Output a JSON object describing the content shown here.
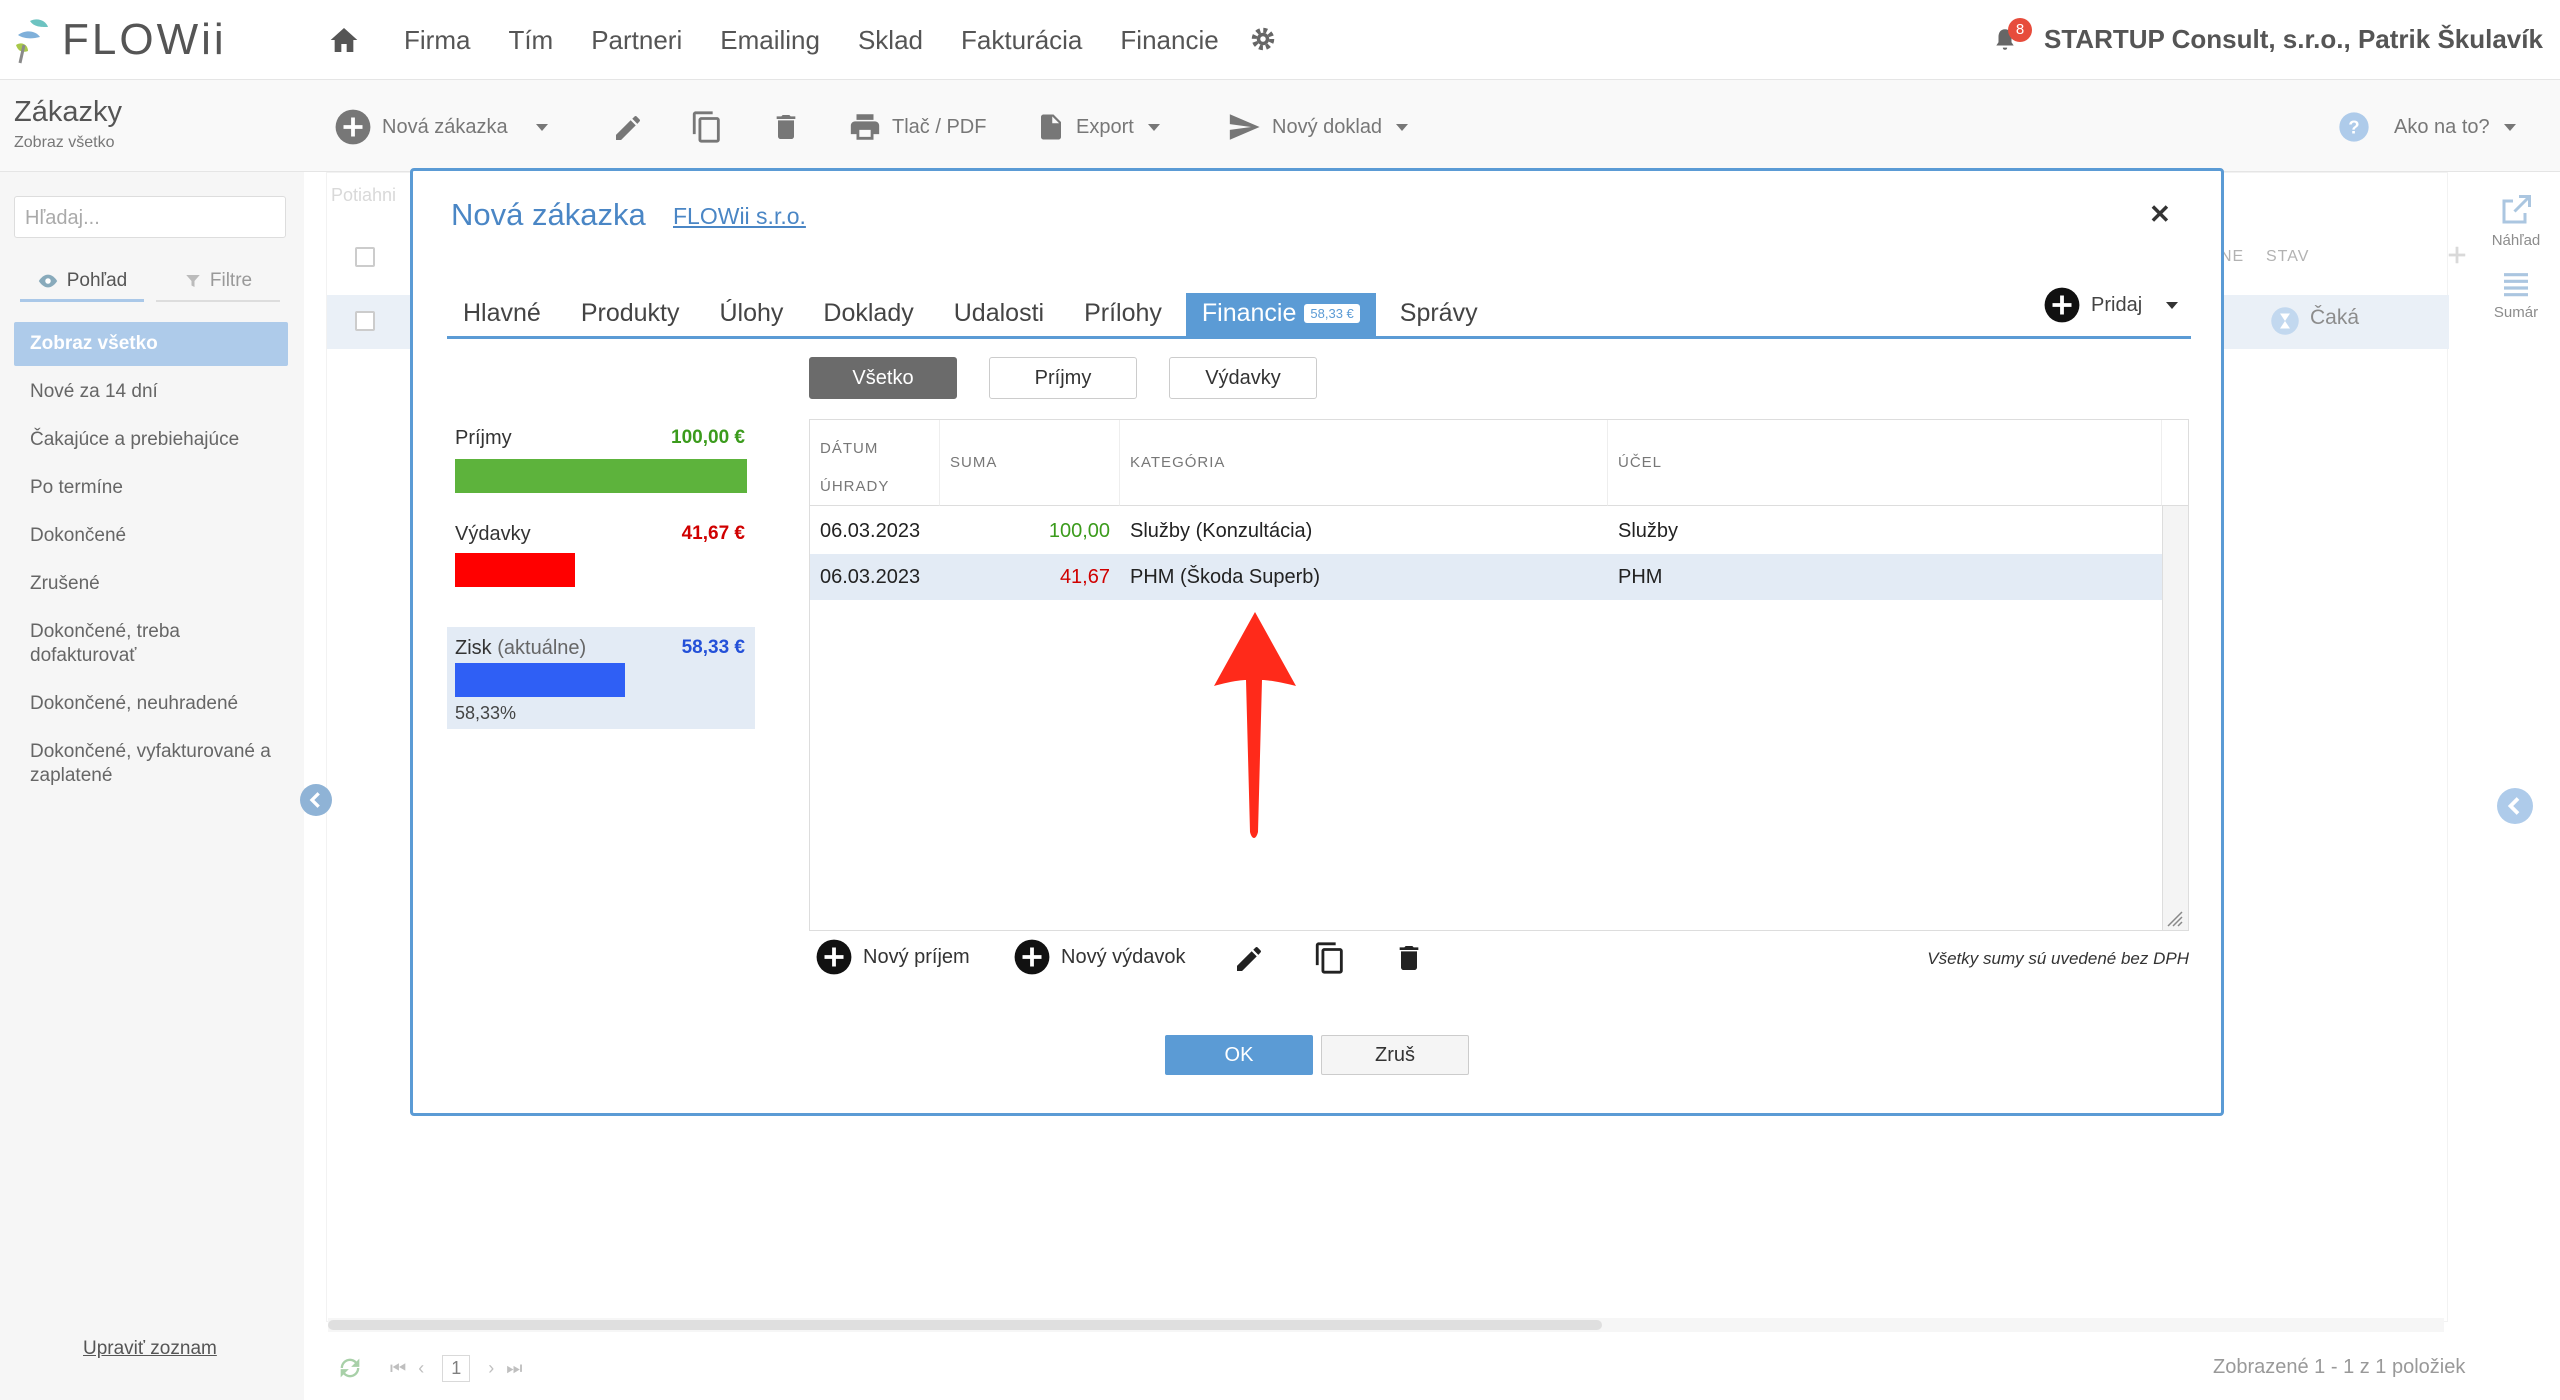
{
  "app": {
    "name": "FLOWii"
  },
  "nav": {
    "items": [
      "Firma",
      "Tím",
      "Partneri",
      "Emailing",
      "Sklad",
      "Fakturácia",
      "Financie"
    ]
  },
  "user": {
    "company": "STARTUP Consult, s.r.o., Patrik Škulavík",
    "notifications": "8"
  },
  "page": {
    "title": "Zákazky",
    "subtitle": "Zobraz všetko"
  },
  "toolbar": {
    "new_order": "Nová zákazka",
    "print": "Tlač / PDF",
    "export": "Export",
    "new_doc": "Nový doklad",
    "help": "Ako na to?"
  },
  "sidebar": {
    "search_placeholder": "Hľadaj...",
    "tab_view": "Pohľad",
    "tab_filter": "Filtre",
    "items": [
      "Zobraz všetko",
      "Nové za 14 dní",
      "Čakajúce a prebiehajúce",
      "Po termíne",
      "Dokončené",
      "Zrušené",
      "Dokončené, treba dofakturovať",
      "Dokončené, neuhradené",
      "Dokončené, vyfakturované a zaplatené"
    ],
    "edit_list": "Upraviť zoznam"
  },
  "list": {
    "col_ne": "NE",
    "col_stav": "STAV",
    "status_value": "Čaká",
    "drag_hint": "Potiahni",
    "footer": "Zobrazené 1 - 1 z 1 položiek",
    "page": "1"
  },
  "rail": {
    "preview": "Náhľad",
    "summary": "Sumár"
  },
  "modal": {
    "title": "Nová zákazka",
    "client_link": "FLOWii s.r.o.",
    "tabs": [
      "Hlavné",
      "Produkty",
      "Úlohy",
      "Doklady",
      "Udalosti",
      "Prílohy",
      "Financie",
      "Správy"
    ],
    "active_tab": "Financie",
    "active_badge": "58,33 €",
    "add_label": "Pridaj",
    "filters": [
      "Všetko",
      "Príjmy",
      "Výdavky"
    ],
    "income_label": "Príjmy",
    "income_value": "100,00 €",
    "expense_label": "Výdavky",
    "expense_value": "41,67 €",
    "profit_label": "Zisk",
    "profit_note": "(aktuálne)",
    "profit_value": "58,33 €",
    "profit_pct": "58,33%",
    "income_color": "#5db33c",
    "expense_color": "#ff0000",
    "profit_color": "#2f5ff5",
    "grid": {
      "headers": [
        "DÁTUM ÚHRADY",
        "SUMA",
        "KATEGÓRIA",
        "ÚČEL"
      ],
      "rows": [
        {
          "date": "06.03.2023",
          "amount": "100,00",
          "category": "Služby (Konzultácia)",
          "purpose": "Služby"
        },
        {
          "date": "06.03.2023",
          "amount": "41,67",
          "category": "PHM (Škoda Superb)",
          "purpose": "PHM"
        }
      ]
    },
    "new_income": "Nový príjem",
    "new_expense": "Nový výdavok",
    "vat_note": "Všetky sumy sú uvedené bez DPH",
    "ok": "OK",
    "cancel": "Zruš"
  }
}
